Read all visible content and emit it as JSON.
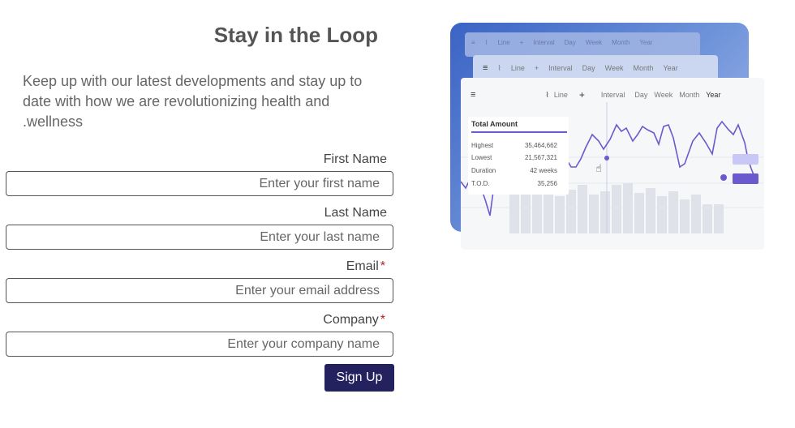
{
  "title": "Stay in the Loop",
  "intro": "Keep up with our latest developments and stay up to date with how we are revolutionizing health and .wellness",
  "form": {
    "first_name": {
      "label": "First Name",
      "placeholder": "Enter your first name"
    },
    "last_name": {
      "label": "Last Name",
      "placeholder": "Enter your last name"
    },
    "email": {
      "label": "Email",
      "required_mark": "*",
      "placeholder": "Enter your email address"
    },
    "company": {
      "label": "Company",
      "required_mark": "*",
      "placeholder": "Enter your company name"
    },
    "submit_label": "Sign Up"
  },
  "illustration": {
    "toolbar": {
      "chart_type": "Line",
      "interval": "Interval",
      "ranges": [
        "Day",
        "Week",
        "Month",
        "Year"
      ]
    },
    "tooltip": {
      "heading": "Total Amount",
      "rows": [
        {
          "label": "Highest",
          "value": "35,464,662"
        },
        {
          "label": "Lowest",
          "value": "21,567,321"
        },
        {
          "label": "Duration",
          "value": "42 weeks"
        },
        {
          "label": "T.O.D.",
          "value": "35,256"
        }
      ]
    },
    "colors": {
      "line": "#6a5acd",
      "legend_light": "#c9c7f5",
      "legend_dark": "#6a5acd",
      "card_gradient_start": "#3a63c4"
    },
    "icons": [
      "hamburger-icon",
      "line-chart-icon",
      "plus-icon",
      "cursor-hand-icon"
    ]
  }
}
